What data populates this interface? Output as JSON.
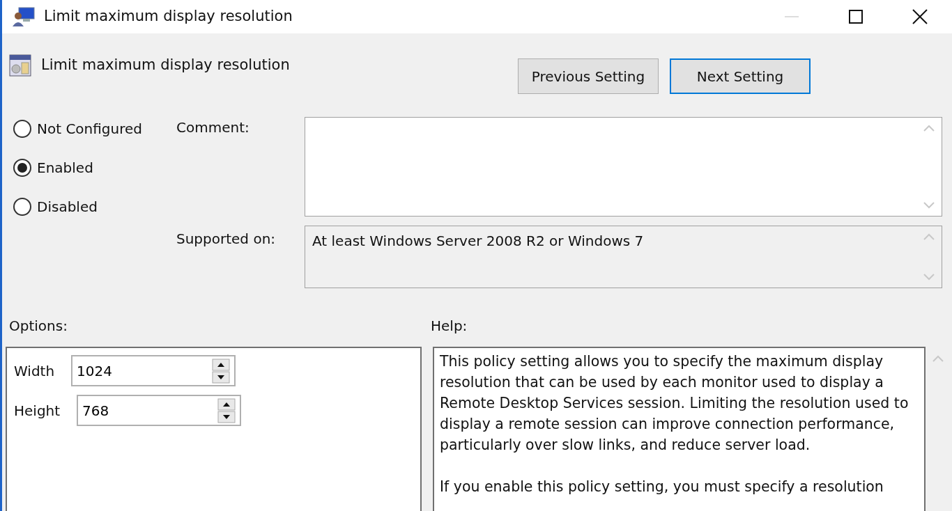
{
  "window": {
    "title": "Limit maximum display resolution"
  },
  "header": {
    "title": "Limit maximum display resolution"
  },
  "nav_buttons": [
    {
      "label": "Previous Setting",
      "focused": false
    },
    {
      "label": "Next Setting",
      "focused": true
    }
  ],
  "state_options": [
    {
      "label": "Not Configured",
      "selected": false
    },
    {
      "label": "Enabled",
      "selected": true
    },
    {
      "label": "Disabled",
      "selected": false
    }
  ],
  "comment": {
    "label": "Comment:"
  },
  "supported_on": {
    "label": "Supported on:",
    "value": "At least Windows Server 2008 R2 or Windows 7"
  },
  "options": {
    "label": "Options:",
    "fields": [
      {
        "label": "Width",
        "value": "1024"
      },
      {
        "label": "Height",
        "value": "768"
      }
    ]
  },
  "help": {
    "label": "Help:",
    "paragraphs": [
      "This policy setting allows you to specify the maximum display resolution that can be used by each monitor used to display a Remote Desktop Services session. Limiting the resolution used to display a remote session can improve connection performance, particularly over slow links, and reduce server load.",
      "If you enable this policy setting, you must specify a resolution"
    ]
  }
}
